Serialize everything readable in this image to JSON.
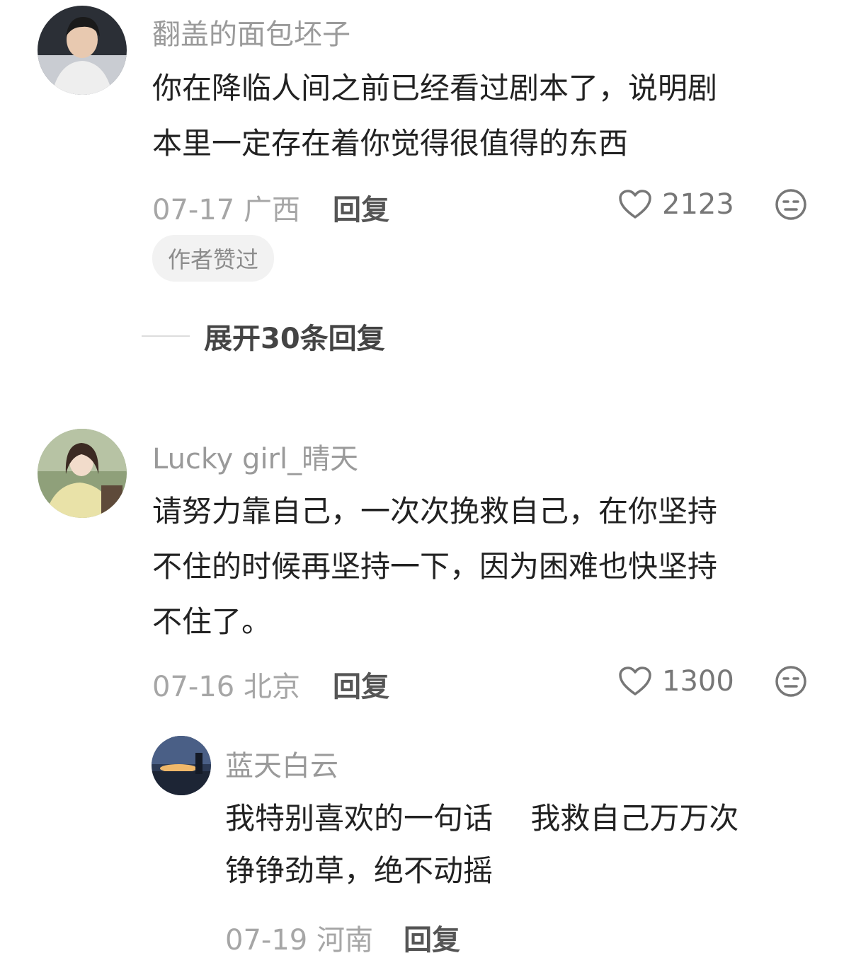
{
  "comments": [
    {
      "username": "翻盖的面包坯子",
      "text_lines": [
        "你在降临人间之前已经看过剧本了，说明剧",
        "本里一定存在着你觉得很值得的东西"
      ],
      "date": "07-17",
      "location": "广西",
      "reply_label": "回复",
      "likes": "2123",
      "badge": "作者赞过",
      "expand_label": "展开30条回复"
    },
    {
      "username": "Lucky girl_晴天",
      "text_lines": [
        "请努力靠自己，一次次挽救自己，在你坚持",
        "不住的时候再坚持一下，因为困难也快坚持",
        "不住了。"
      ],
      "date": "07-16",
      "location": "北京",
      "reply_label": "回复",
      "likes": "1300",
      "replies": [
        {
          "username": "蓝天白云",
          "text_lines": [
            "我特别喜欢的一句话    我救自己万万次",
            "铮铮劲草，绝不动摇"
          ],
          "date": "07-19",
          "location": "河南",
          "reply_label": "回复"
        }
      ]
    }
  ],
  "icons": {
    "like": "heart-outline-icon",
    "dislike": "neutral-face-icon"
  },
  "colors": {
    "username": "#9a9a9a",
    "meta": "#a6a6a6",
    "badge_bg": "#f2f2f2"
  }
}
